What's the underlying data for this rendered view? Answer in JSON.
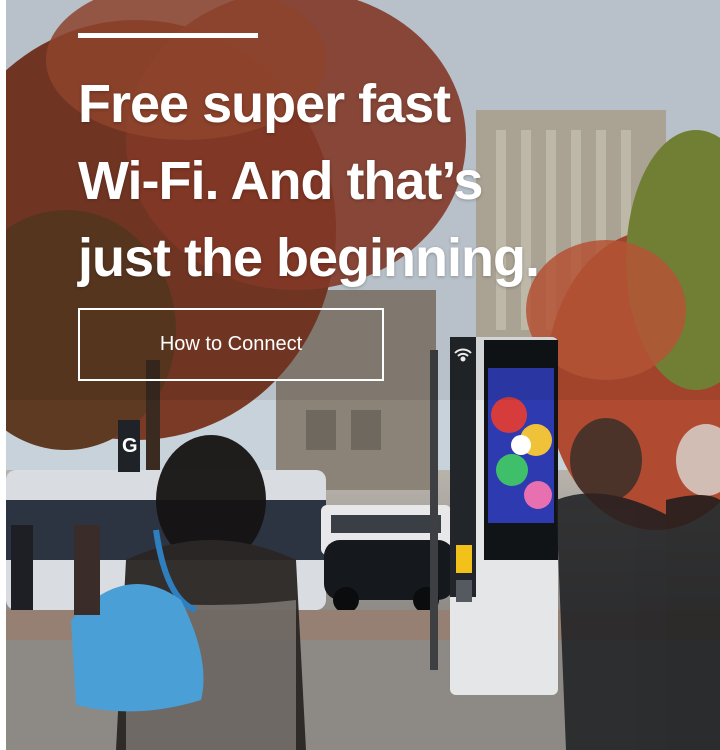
{
  "hero": {
    "headline_lines": [
      "Free super fast",
      "Wi-Fi. And that’s",
      "just the beginning."
    ],
    "cta_label": "How to Connect",
    "bus_sign": "G",
    "wifi_icon": "wifi-icon"
  },
  "colors": {
    "text": "#ffffff",
    "kiosk_body": "#e4e6e8",
    "kiosk_panel": "#111417",
    "bag": "#4a9fd6",
    "foliage": "#a5492e"
  }
}
